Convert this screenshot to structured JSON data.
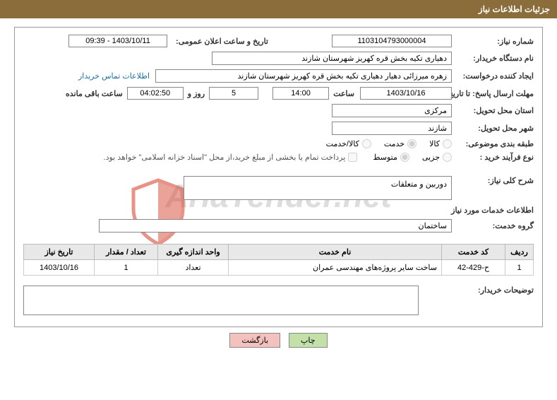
{
  "header": {
    "title": "جزئیات اطلاعات نیاز"
  },
  "fields": {
    "need_number_label": "شماره نیاز:",
    "need_number": "1103104793000004",
    "announce_label": "تاریخ و ساعت اعلان عمومی:",
    "announce_value": "1403/10/11 - 09:39",
    "buyer_org_label": "نام دستگاه خریدار:",
    "buyer_org": "دهیاری تکیه بخش قره کهریز شهرستان شازند",
    "requester_label": "ایجاد کننده درخواست:",
    "requester": "زهره میرزائی دهیار دهیاری تکیه بخش قره کهریز شهرستان شازند",
    "contact_link": "اطلاعات تماس خریدار",
    "deadline_label": "مهلت ارسال پاسخ: تا تاریخ:",
    "deadline_date": "1403/10/16",
    "time_label": "ساعت",
    "deadline_time": "14:00",
    "days_count": "5",
    "days_and_label": "روز و",
    "countdown_time": "04:02:50",
    "remaining_label": "ساعت باقی مانده",
    "province_label": "استان محل تحویل:",
    "province": "مرکزی",
    "city_label": "شهر محل تحویل:",
    "city": "شازند",
    "category_label": "طبقه بندی موضوعی:",
    "cat_goods": "کالا",
    "cat_service": "خدمت",
    "cat_goods_service": "کالا/خدمت",
    "purchase_type_label": "نوع فرآیند خرید :",
    "pt_minor": "جزیی",
    "pt_medium": "متوسط",
    "treasury_note": "پرداخت تمام یا بخشی از مبلغ خرید،از محل \"اسناد خزانه اسلامی\" خواهد بود.",
    "general_desc_label": "شرح کلی نیاز:",
    "general_desc": "دوربین و متعلقات",
    "services_info_title": "اطلاعات خدمات مورد نیاز",
    "service_group_label": "گروه خدمت:",
    "service_group": "ساختمان",
    "buyer_notes_label": "توضیحات خریدار:"
  },
  "table": {
    "headers": {
      "row": "ردیف",
      "service_code": "کد خدمت",
      "service_name": "نام خدمت",
      "unit": "واحد اندازه گیری",
      "qty": "تعداد / مقدار",
      "need_date": "تاریخ نیاز"
    },
    "rows": [
      {
        "row": "1",
        "service_code": "ح-429-42",
        "service_name": "ساخت سایر پروژه‌های مهندسی عمران",
        "unit": "تعداد",
        "qty": "1",
        "need_date": "1403/10/16"
      }
    ]
  },
  "buttons": {
    "print": "چاپ",
    "back": "بازگشت"
  },
  "watermark": "AriaTender.net"
}
